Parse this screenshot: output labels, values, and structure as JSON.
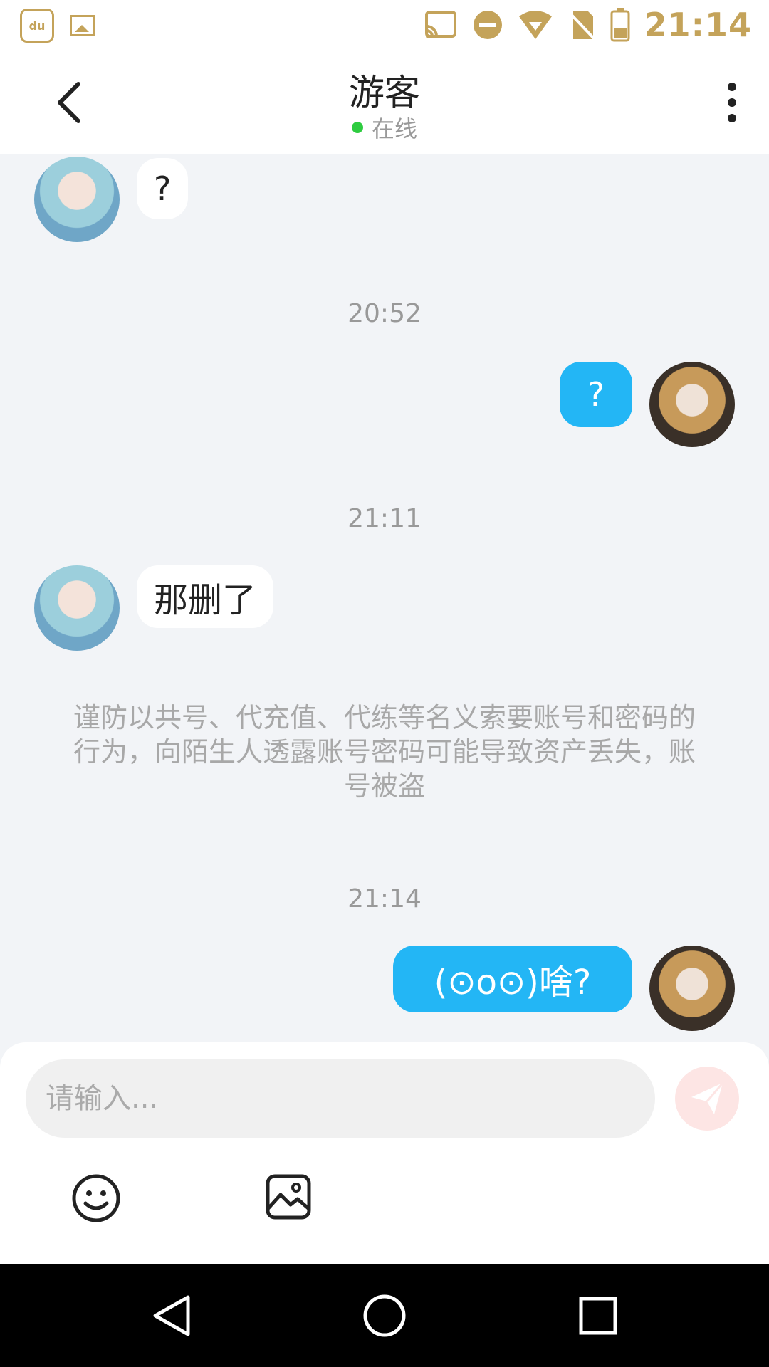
{
  "status_bar": {
    "time": "21:14",
    "left_icons": [
      "baidu-app-icon",
      "gallery-icon"
    ],
    "right_icons": [
      "cast-icon",
      "do-not-disturb-icon",
      "wifi-icon",
      "no-sim-icon",
      "battery-icon"
    ],
    "baidu_icon_text": "du"
  },
  "header": {
    "title": "游客",
    "status": "在线"
  },
  "messages": [
    {
      "side": "in",
      "text": "?"
    },
    {
      "timestamp": "20:52"
    },
    {
      "side": "out",
      "text": "?"
    },
    {
      "timestamp": "21:11"
    },
    {
      "side": "in",
      "text": "那删了"
    },
    {
      "notice": "谨防以共号、代充值、代练等名义索要账号和密码的行为，向陌生人透露账号密码可能导致资产丢失，账号被盗"
    },
    {
      "timestamp": "21:14"
    },
    {
      "side": "out",
      "text": "(⊙o⊙)啥?"
    }
  ],
  "chat": {
    "msg1": "?",
    "ts1": "20:52",
    "msg2": "?",
    "ts2": "21:11",
    "msg3": "那删了",
    "notice": "谨防以共号、代充值、代练等名义索要账号和密码的行为，向陌生人透露账号密码可能导致资产丢失，账号被盗",
    "ts3": "21:14",
    "msg4": "(⊙o⊙)啥?"
  },
  "input": {
    "placeholder": "请输入...",
    "value": ""
  },
  "colors": {
    "accent_blue": "#23b6f5",
    "online_green": "#2ecc40",
    "send_disabled": "#fde5e4",
    "status_gold": "#c4a35a"
  }
}
